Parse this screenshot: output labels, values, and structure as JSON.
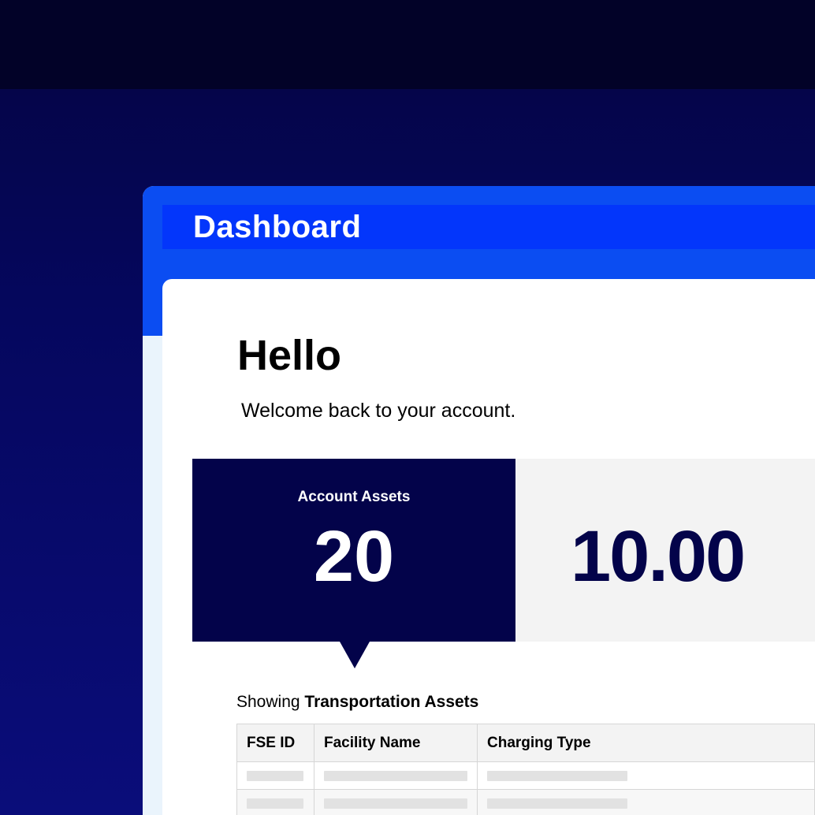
{
  "window": {
    "title": "Dashboard"
  },
  "greeting": {
    "heading": "Hello",
    "subtitle": "Welcome back to your account."
  },
  "stats": {
    "account_assets_label": "Account Assets",
    "account_assets_value": "20",
    "secondary_value": "10.00"
  },
  "table": {
    "showing_prefix": "Showing",
    "showing_category": "Transportation Assets",
    "columns": [
      "FSE ID",
      "Facility Name",
      "Charging Type"
    ]
  },
  "colors": {
    "brand_blue": "#0336fb",
    "navy": "#03034a",
    "background": "#05075e"
  }
}
